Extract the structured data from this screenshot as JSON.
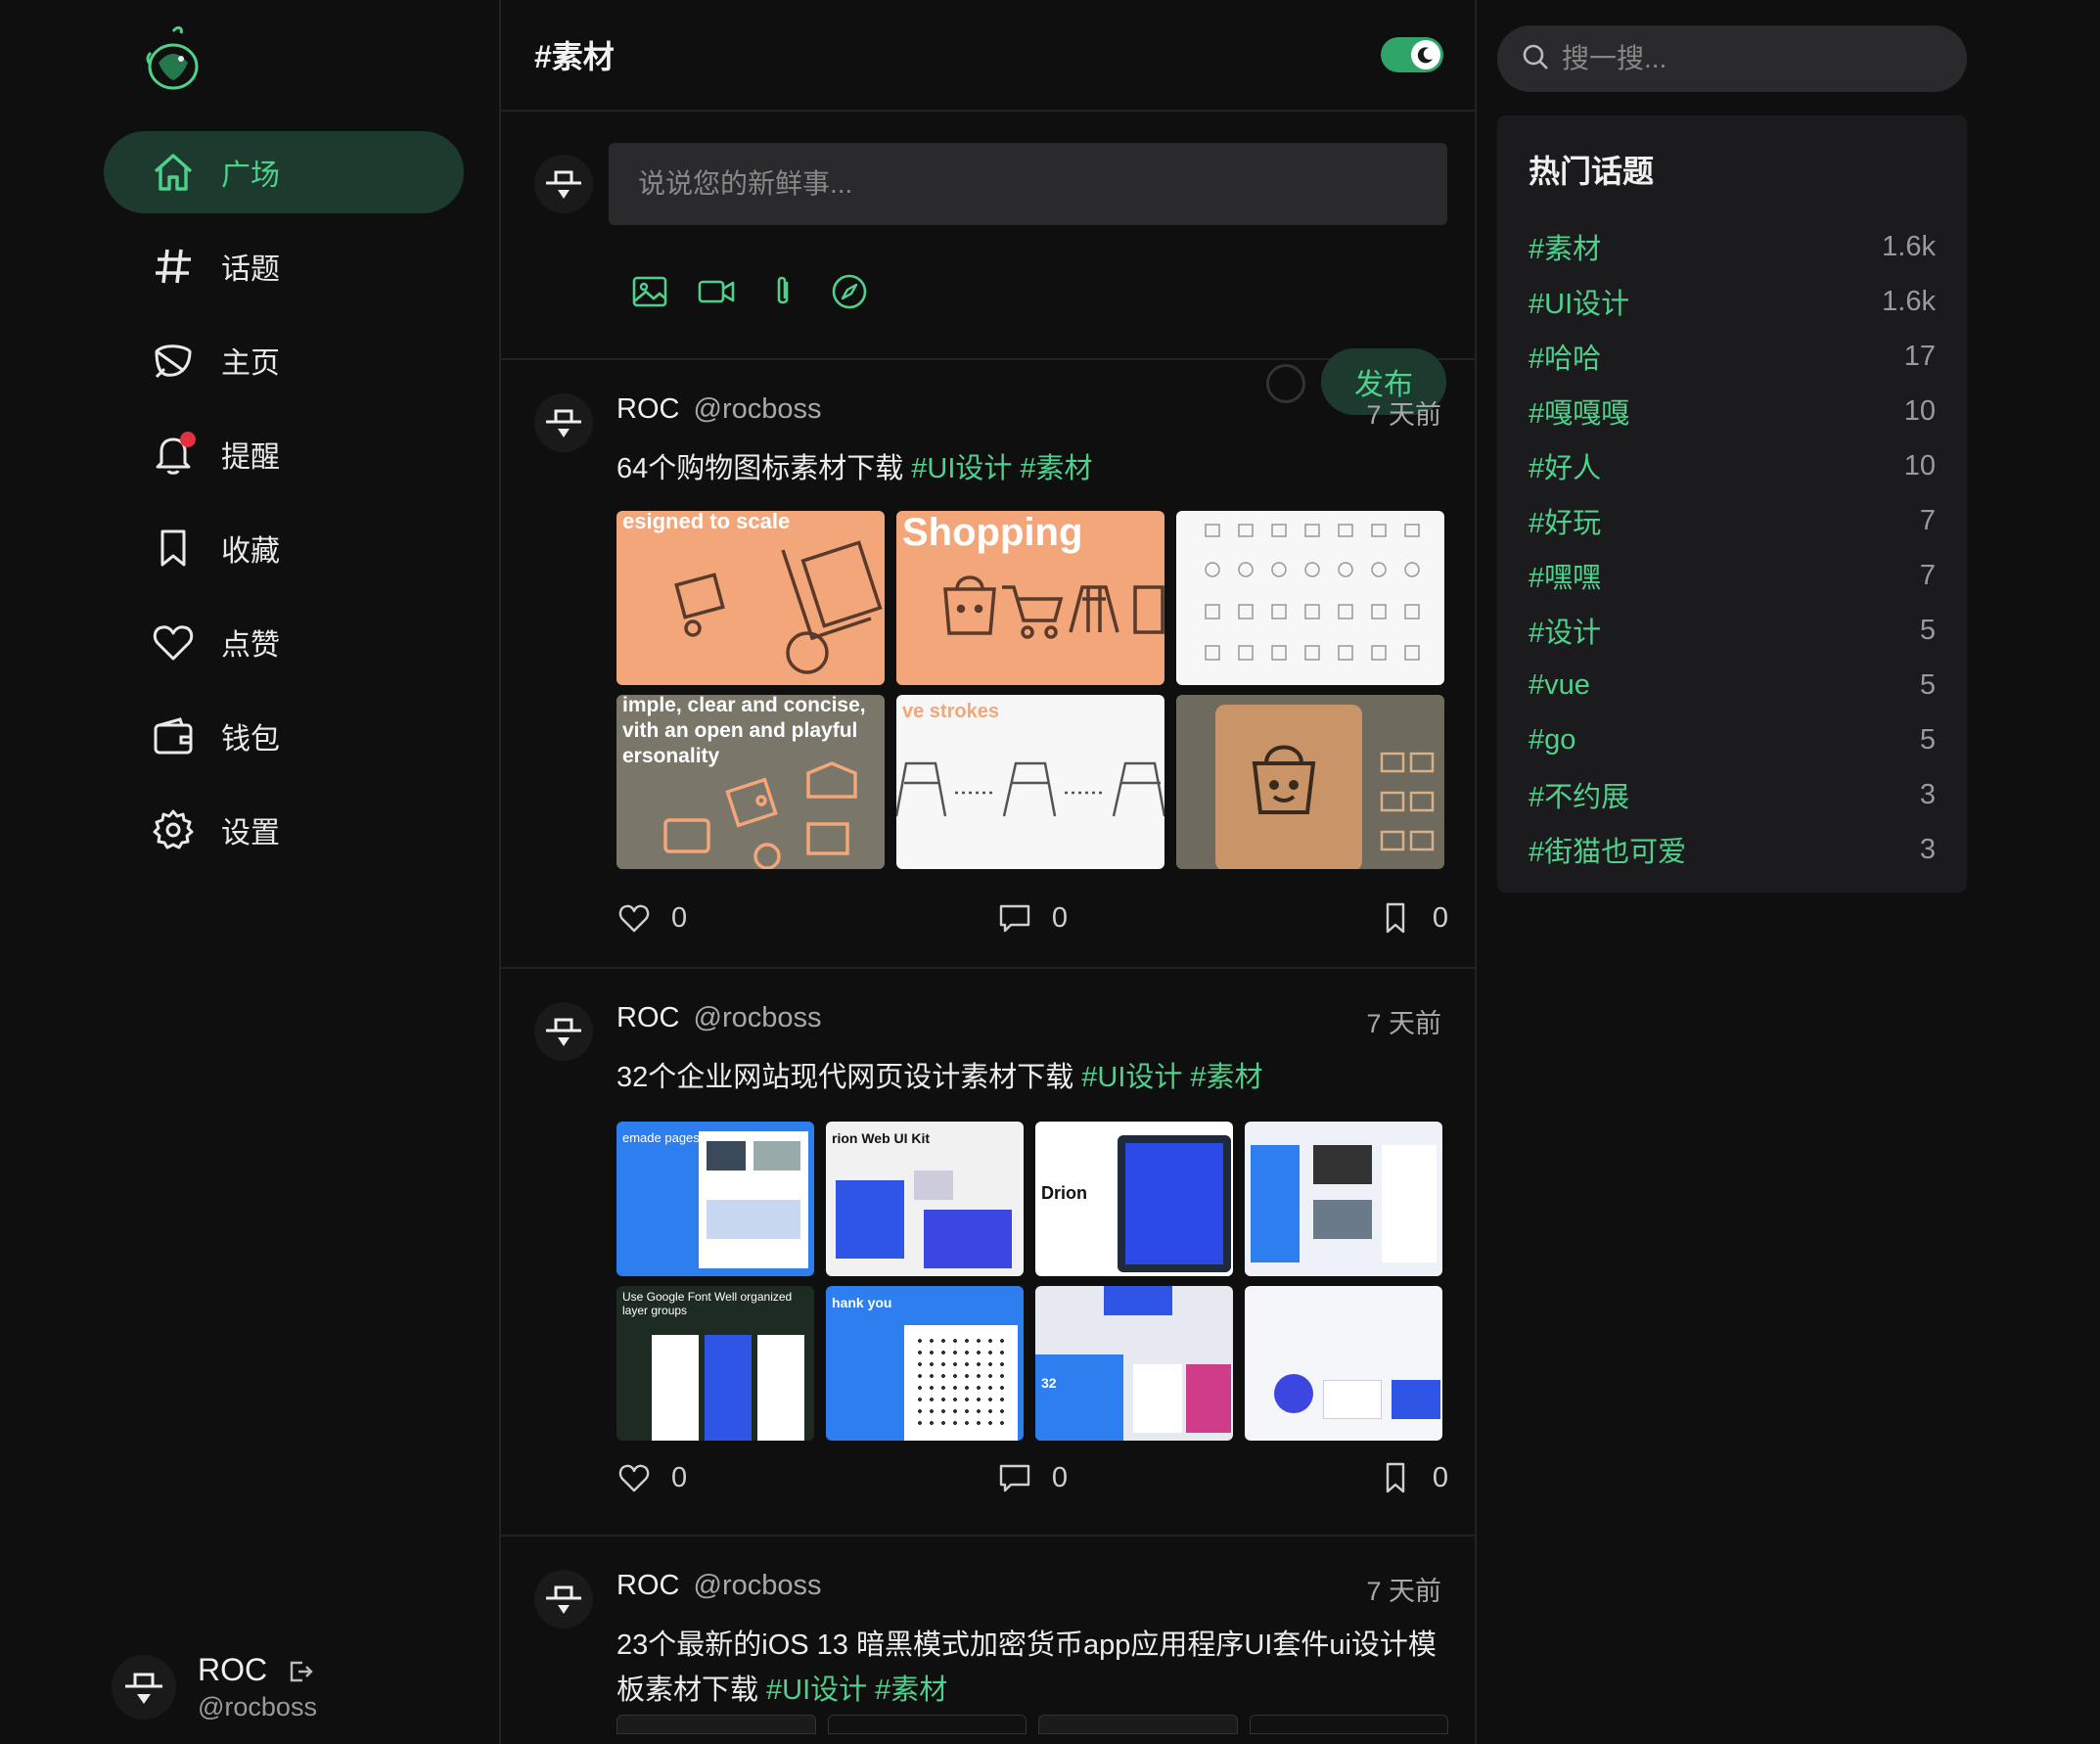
{
  "sidebar": {
    "items": [
      {
        "label": "广场",
        "icon": "home-icon",
        "active": true
      },
      {
        "label": "话题",
        "icon": "hash-icon"
      },
      {
        "label": "主页",
        "icon": "leaf-icon"
      },
      {
        "label": "提醒",
        "icon": "bell-icon",
        "badge": true
      },
      {
        "label": "收藏",
        "icon": "bookmark-icon"
      },
      {
        "label": "点赞",
        "icon": "heart-icon"
      },
      {
        "label": "钱包",
        "icon": "wallet-icon"
      },
      {
        "label": "设置",
        "icon": "gear-icon"
      }
    ],
    "user": {
      "name": "ROC",
      "handle": "@rocboss"
    }
  },
  "main": {
    "title": "#素材",
    "composer": {
      "placeholder": "说说您的新鲜事...",
      "publish_label": "发布"
    },
    "posts": [
      {
        "author": "ROC",
        "handle": "@rocboss",
        "time": "7 天前",
        "text": "64个购物图标素材下载",
        "tags": [
          "#UI设计",
          "#素材"
        ],
        "images": [
          {
            "caption": "esigned to scale"
          },
          {
            "caption": "Shopping"
          },
          {
            "caption": ""
          },
          {
            "caption": "imple, clear and concise, vith an open and playful ersonality"
          },
          {
            "caption": "ve strokes"
          },
          {
            "caption": ""
          }
        ],
        "likes": "0",
        "comments": "0",
        "collects": "0"
      },
      {
        "author": "ROC",
        "handle": "@rocboss",
        "time": "7 天前",
        "text": "32个企业网站现代网页设计素材下载",
        "tags": [
          "#UI设计",
          "#素材"
        ],
        "images": [
          {
            "caption": "emade pages"
          },
          {
            "caption": "rion Web UI Kit"
          },
          {
            "caption": "Drion"
          },
          {
            "caption": ""
          },
          {
            "caption": "Use Google Font Well organized layer groups"
          },
          {
            "caption": "hank you"
          },
          {
            "caption": "32"
          },
          {
            "caption": ""
          }
        ],
        "likes": "0",
        "comments": "0",
        "collects": "0"
      },
      {
        "author": "ROC",
        "handle": "@rocboss",
        "time": "7 天前",
        "text": "23个最新的iOS 13 暗黑模式加密货币app应用程序UI套件ui设计模板素材下载",
        "tags": [
          "#UI设计",
          "#素材"
        ]
      }
    ]
  },
  "right": {
    "search_placeholder": "搜一搜...",
    "topics_title": "热门话题",
    "topics": [
      {
        "name": "#素材",
        "count": "1.6k"
      },
      {
        "name": "#UI设计",
        "count": "1.6k"
      },
      {
        "name": "#哈哈",
        "count": "17"
      },
      {
        "name": "#嘎嘎嘎",
        "count": "10"
      },
      {
        "name": "#好人",
        "count": "10"
      },
      {
        "name": "#好玩",
        "count": "7"
      },
      {
        "name": "#嘿嘿",
        "count": "7"
      },
      {
        "name": "#设计",
        "count": "5"
      },
      {
        "name": "#vue",
        "count": "5"
      },
      {
        "name": "#go",
        "count": "5"
      },
      {
        "name": "#不约展",
        "count": "3"
      },
      {
        "name": "#街猫也可爱",
        "count": "3"
      }
    ]
  },
  "colors": {
    "accent": "#4fd18b",
    "accent_bg": "#1d3a2e",
    "background": "#0f0f10",
    "badge": "#e0313d"
  }
}
